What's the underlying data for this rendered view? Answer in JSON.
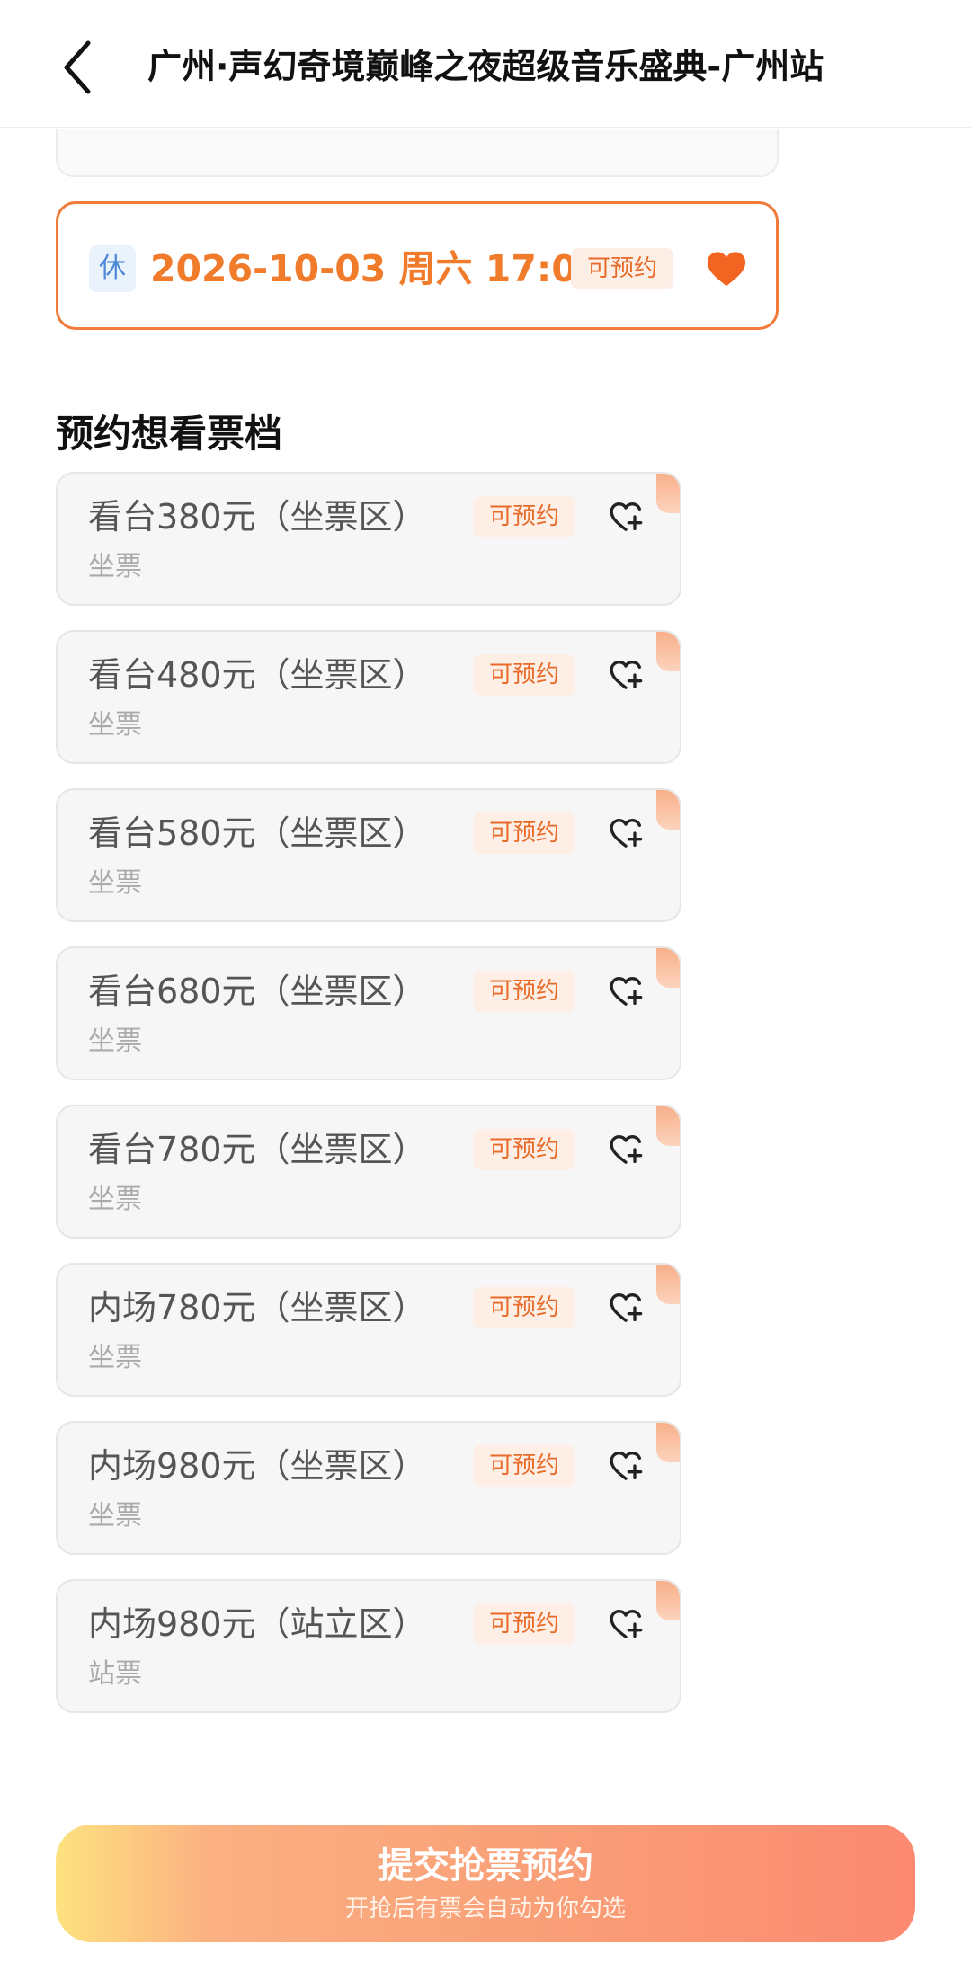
{
  "header": {
    "title": "广州·声幻奇境巅峰之夜超级音乐盛典-广州站"
  },
  "session": {
    "rest_badge": "休",
    "date": "2026-10-03 周六 17:00",
    "status": "可预约"
  },
  "section_title": "预约想看票档",
  "tiers": [
    {
      "name": "看台380元（坐票区）",
      "sub": "坐票",
      "status": "可预约"
    },
    {
      "name": "看台480元（坐票区）",
      "sub": "坐票",
      "status": "可预约"
    },
    {
      "name": "看台580元（坐票区）",
      "sub": "坐票",
      "status": "可预约"
    },
    {
      "name": "看台680元（坐票区）",
      "sub": "坐票",
      "status": "可预约"
    },
    {
      "name": "看台780元（坐票区）",
      "sub": "坐票",
      "status": "可预约"
    },
    {
      "name": "内场780元（坐票区）",
      "sub": "坐票",
      "status": "可预约"
    },
    {
      "name": "内场980元（坐票区）",
      "sub": "坐票",
      "status": "可预约"
    },
    {
      "name": "内场980元（站立区）",
      "sub": "站票",
      "status": "可预约"
    }
  ],
  "footer": {
    "submit_label": "提交抢票预约",
    "submit_sub": "开抢后有票会自动为你勾选"
  },
  "colors": {
    "accent": "#f07b2b",
    "tag_bg": "#fdefe6",
    "rest_badge": "#4c87d8"
  },
  "icons": {
    "back": "chevron-left-icon",
    "session_favorite": "heart-filled-icon",
    "tier_favorite": "heart-plus-icon"
  }
}
